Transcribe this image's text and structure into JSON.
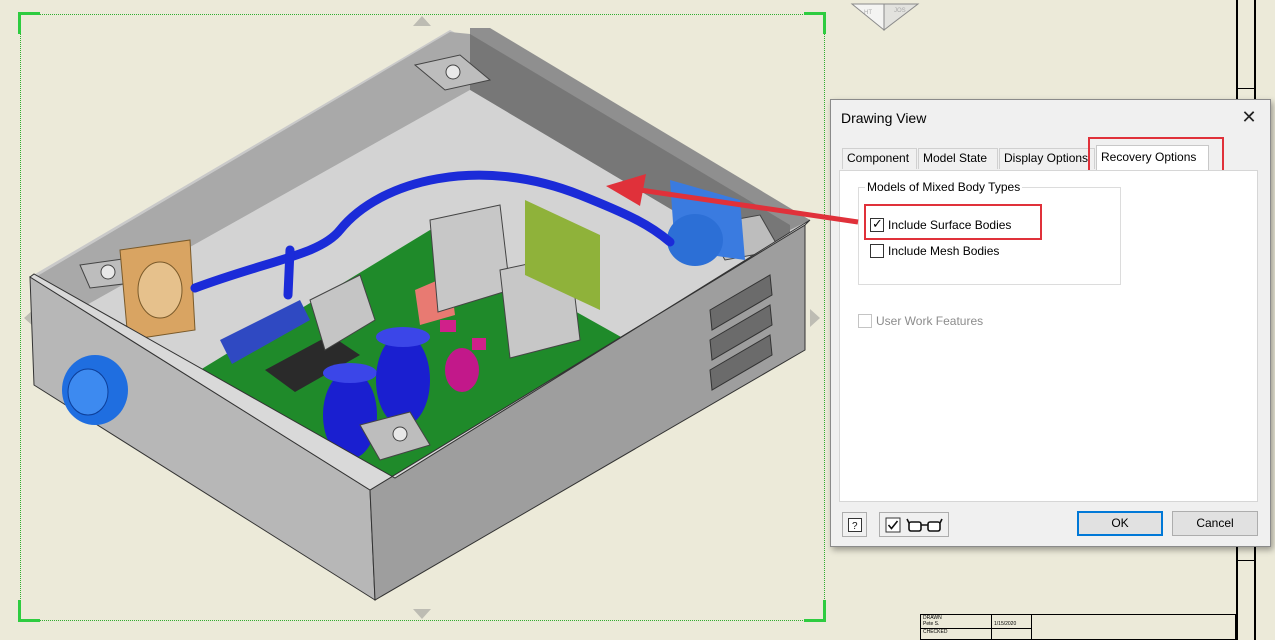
{
  "dialog": {
    "title": "Drawing View",
    "close_icon": "close-icon",
    "tabs": [
      {
        "label": "Component",
        "active": false
      },
      {
        "label": "Model State",
        "active": false
      },
      {
        "label": "Display Options",
        "active": false
      },
      {
        "label": "Recovery Options",
        "active": true
      }
    ],
    "group_label": "Models of Mixed Body Types",
    "include_surface_bodies": {
      "label": "Include Surface Bodies",
      "checked": true
    },
    "include_mesh_bodies": {
      "label": "Include Mesh Bodies",
      "checked": false
    },
    "user_work_features": {
      "label": "User Work Features",
      "checked": false,
      "enabled": false
    },
    "help_icon": "help-icon",
    "preview_icon": "glasses-icon",
    "ok_label": "OK",
    "cancel_label": "Cancel"
  },
  "title_block": {
    "drawn_label": "DRAWN",
    "drawn_name": "Pete S.",
    "drawn_date": "1/15/2020",
    "checked_label": "CHECKED"
  },
  "canvas": {
    "accent_green": "#2ecc40",
    "highlight_red": "#e0313a"
  }
}
